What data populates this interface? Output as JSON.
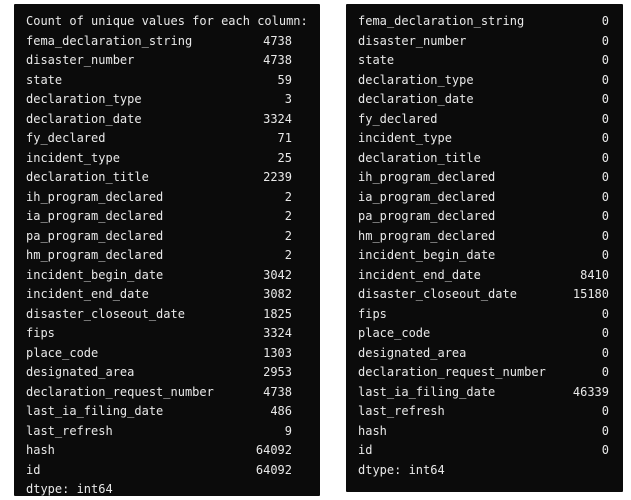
{
  "left": {
    "header": "Count of unique values for each column:",
    "rows": [
      {
        "name": "fema_declaration_string",
        "value": "4738"
      },
      {
        "name": "disaster_number",
        "value": "4738"
      },
      {
        "name": "state",
        "value": "59"
      },
      {
        "name": "declaration_type",
        "value": "3"
      },
      {
        "name": "declaration_date",
        "value": "3324"
      },
      {
        "name": "fy_declared",
        "value": "71"
      },
      {
        "name": "incident_type",
        "value": "25"
      },
      {
        "name": "declaration_title",
        "value": "2239"
      },
      {
        "name": "ih_program_declared",
        "value": "2"
      },
      {
        "name": "ia_program_declared",
        "value": "2"
      },
      {
        "name": "pa_program_declared",
        "value": "2"
      },
      {
        "name": "hm_program_declared",
        "value": "2"
      },
      {
        "name": "incident_begin_date",
        "value": "3042"
      },
      {
        "name": "incident_end_date",
        "value": "3082"
      },
      {
        "name": "disaster_closeout_date",
        "value": "1825"
      },
      {
        "name": "fips",
        "value": "3324"
      },
      {
        "name": "place_code",
        "value": "1303"
      },
      {
        "name": "designated_area",
        "value": "2953"
      },
      {
        "name": "declaration_request_number",
        "value": "4738"
      },
      {
        "name": "last_ia_filing_date",
        "value": "486"
      },
      {
        "name": "last_refresh",
        "value": "9"
      },
      {
        "name": "hash",
        "value": "64092"
      },
      {
        "name": "id",
        "value": "64092"
      }
    ],
    "dtype": "dtype: int64"
  },
  "right": {
    "rows": [
      {
        "name": "fema_declaration_string",
        "value": "0"
      },
      {
        "name": "disaster_number",
        "value": "0"
      },
      {
        "name": "state",
        "value": "0"
      },
      {
        "name": "declaration_type",
        "value": "0"
      },
      {
        "name": "declaration_date",
        "value": "0"
      },
      {
        "name": "fy_declared",
        "value": "0"
      },
      {
        "name": "incident_type",
        "value": "0"
      },
      {
        "name": "declaration_title",
        "value": "0"
      },
      {
        "name": "ih_program_declared",
        "value": "0"
      },
      {
        "name": "ia_program_declared",
        "value": "0"
      },
      {
        "name": "pa_program_declared",
        "value": "0"
      },
      {
        "name": "hm_program_declared",
        "value": "0"
      },
      {
        "name": "incident_begin_date",
        "value": "0"
      },
      {
        "name": "incident_end_date",
        "value": "8410"
      },
      {
        "name": "disaster_closeout_date",
        "value": "15180"
      },
      {
        "name": "fips",
        "value": "0"
      },
      {
        "name": "place_code",
        "value": "0"
      },
      {
        "name": "designated_area",
        "value": "0"
      },
      {
        "name": "declaration_request_number",
        "value": "0"
      },
      {
        "name": "last_ia_filing_date",
        "value": "46339"
      },
      {
        "name": "last_refresh",
        "value": "0"
      },
      {
        "name": "hash",
        "value": "0"
      },
      {
        "name": "id",
        "value": "0"
      }
    ],
    "dtype": "dtype: int64"
  },
  "colors": {
    "panel_background": "#0b0b0b",
    "text": "#e9e9e9",
    "page_background": "#ffffff"
  }
}
